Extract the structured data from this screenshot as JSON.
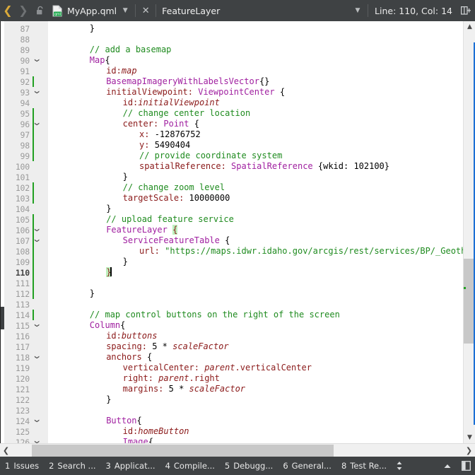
{
  "toolbar": {
    "back_icon": "chevron-left-icon",
    "forward_icon": "chevron-right-icon",
    "lock_icon": "unlocked-padlock-icon",
    "file_type_icon": "qml-file-icon",
    "file_type_label": "qml",
    "filename": "MyApp.qml",
    "file_dropdown_icon": "chevron-down-icon",
    "close_icon": "close-x-icon",
    "symbol": "FeatureLayer",
    "symbol_dropdown_icon": "chevron-down-icon",
    "cursor_position": "Line: 110, Col: 14",
    "split_icon": "split-editor-icon"
  },
  "editor": {
    "first_line": 87,
    "current_line": 110,
    "lines": [
      {
        "n": 87,
        "fold": false,
        "changed": false,
        "indent": 2,
        "tokens": [
          {
            "t": "}",
            "c": "tok-op"
          }
        ]
      },
      {
        "n": 88,
        "fold": false,
        "changed": false,
        "indent": 0,
        "tokens": []
      },
      {
        "n": 89,
        "fold": false,
        "changed": false,
        "indent": 2,
        "tokens": [
          {
            "t": "// add a basemap",
            "c": "tok-cm"
          }
        ]
      },
      {
        "n": 90,
        "fold": true,
        "changed": false,
        "indent": 2,
        "tokens": [
          {
            "t": "Map",
            "c": "tok-ty"
          },
          {
            "t": "{",
            "c": "tok-op"
          }
        ]
      },
      {
        "n": 91,
        "fold": false,
        "changed": false,
        "indent": 3,
        "tokens": [
          {
            "t": "id:",
            "c": "tok-pr"
          },
          {
            "t": "map",
            "c": "tok-id"
          }
        ]
      },
      {
        "n": 92,
        "fold": false,
        "changed": true,
        "indent": 3,
        "tokens": [
          {
            "t": "BasemapImageryWithLabelsVector",
            "c": "tok-ty"
          },
          {
            "t": "{}",
            "c": "tok-op"
          }
        ]
      },
      {
        "n": 93,
        "fold": true,
        "changed": false,
        "indent": 3,
        "tokens": [
          {
            "t": "initialViewpoint: ",
            "c": "tok-pr"
          },
          {
            "t": "ViewpointCenter",
            "c": "tok-ty"
          },
          {
            "t": " {",
            "c": "tok-op"
          }
        ]
      },
      {
        "n": 94,
        "fold": false,
        "changed": false,
        "indent": 4,
        "tokens": [
          {
            "t": "id:",
            "c": "tok-pr"
          },
          {
            "t": "initialViewpoint",
            "c": "tok-id"
          }
        ]
      },
      {
        "n": 95,
        "fold": false,
        "changed": true,
        "indent": 4,
        "tokens": [
          {
            "t": "// change center location",
            "c": "tok-cm"
          }
        ]
      },
      {
        "n": 96,
        "fold": true,
        "changed": true,
        "indent": 4,
        "tokens": [
          {
            "t": "center: ",
            "c": "tok-pr"
          },
          {
            "t": "Point",
            "c": "tok-ty"
          },
          {
            "t": " {",
            "c": "tok-op"
          }
        ]
      },
      {
        "n": 97,
        "fold": false,
        "changed": true,
        "indent": 5,
        "tokens": [
          {
            "t": "x: ",
            "c": "tok-pr"
          },
          {
            "t": "-12876752",
            "c": "tok-num"
          }
        ]
      },
      {
        "n": 98,
        "fold": false,
        "changed": true,
        "indent": 5,
        "tokens": [
          {
            "t": "y: ",
            "c": "tok-pr"
          },
          {
            "t": "5490404",
            "c": "tok-num"
          }
        ]
      },
      {
        "n": 99,
        "fold": false,
        "changed": true,
        "indent": 5,
        "tokens": [
          {
            "t": "// provide coordinate system",
            "c": "tok-cm"
          }
        ]
      },
      {
        "n": 100,
        "fold": false,
        "changed": false,
        "indent": 5,
        "tokens": [
          {
            "t": "spatialReference: ",
            "c": "tok-pr"
          },
          {
            "t": "SpatialReference",
            "c": "tok-ty"
          },
          {
            "t": " {wkid: ",
            "c": "tok-op"
          },
          {
            "t": "102100",
            "c": "tok-num"
          },
          {
            "t": "}",
            "c": "tok-op"
          }
        ]
      },
      {
        "n": 101,
        "fold": false,
        "changed": false,
        "indent": 4,
        "tokens": [
          {
            "t": "}",
            "c": "tok-op"
          }
        ]
      },
      {
        "n": 102,
        "fold": false,
        "changed": true,
        "indent": 4,
        "tokens": [
          {
            "t": "// change zoom level",
            "c": "tok-cm"
          }
        ]
      },
      {
        "n": 103,
        "fold": false,
        "changed": true,
        "indent": 4,
        "tokens": [
          {
            "t": "targetScale: ",
            "c": "tok-pr"
          },
          {
            "t": "10000000",
            "c": "tok-num"
          }
        ]
      },
      {
        "n": 104,
        "fold": false,
        "changed": false,
        "indent": 3,
        "tokens": [
          {
            "t": "}",
            "c": "tok-op"
          }
        ]
      },
      {
        "n": 105,
        "fold": false,
        "changed": true,
        "indent": 3,
        "tokens": [
          {
            "t": "// upload feature service",
            "c": "tok-cm"
          }
        ]
      },
      {
        "n": 106,
        "fold": true,
        "changed": true,
        "indent": 3,
        "tokens": [
          {
            "t": "FeatureLayer",
            "c": "tok-ty"
          },
          {
            "t": " ",
            "c": "tok-op"
          },
          {
            "t": "{",
            "c": "brace-hl"
          }
        ]
      },
      {
        "n": 107,
        "fold": true,
        "changed": true,
        "indent": 4,
        "tokens": [
          {
            "t": "ServiceFeatureTable",
            "c": "tok-ty"
          },
          {
            "t": " {",
            "c": "tok-op"
          }
        ]
      },
      {
        "n": 108,
        "fold": false,
        "changed": true,
        "indent": 5,
        "tokens": [
          {
            "t": "url: ",
            "c": "tok-pr"
          },
          {
            "t": "\"https://maps.idwr.idaho.gov/arcgis/rest/services/BP/_Geothermal",
            "c": "tok-str"
          }
        ]
      },
      {
        "n": 109,
        "fold": false,
        "changed": true,
        "indent": 4,
        "tokens": [
          {
            "t": "}",
            "c": "tok-op"
          }
        ]
      },
      {
        "n": 110,
        "fold": false,
        "changed": true,
        "indent": 3,
        "tokens": [
          {
            "t": "}",
            "c": "brace-hl"
          }
        ],
        "cursor": true
      },
      {
        "n": 111,
        "fold": false,
        "changed": true,
        "indent": 0,
        "tokens": []
      },
      {
        "n": 112,
        "fold": false,
        "changed": true,
        "indent": 2,
        "tokens": [
          {
            "t": "}",
            "c": "tok-op"
          }
        ]
      },
      {
        "n": 113,
        "fold": false,
        "changed": false,
        "indent": 0,
        "tokens": []
      },
      {
        "n": 114,
        "fold": false,
        "changed": true,
        "indent": 2,
        "tokens": [
          {
            "t": "// map control buttons on the right of the screen",
            "c": "tok-cm"
          }
        ]
      },
      {
        "n": 115,
        "fold": true,
        "changed": false,
        "indent": 2,
        "tokens": [
          {
            "t": "Column",
            "c": "tok-ty"
          },
          {
            "t": "{",
            "c": "tok-op"
          }
        ]
      },
      {
        "n": 116,
        "fold": false,
        "changed": false,
        "indent": 3,
        "tokens": [
          {
            "t": "id:",
            "c": "tok-pr"
          },
          {
            "t": "buttons",
            "c": "tok-id"
          }
        ]
      },
      {
        "n": 117,
        "fold": false,
        "changed": false,
        "indent": 3,
        "tokens": [
          {
            "t": "spacing: ",
            "c": "tok-pr"
          },
          {
            "t": "5",
            "c": "tok-num"
          },
          {
            "t": " * ",
            "c": "tok-op"
          },
          {
            "t": "scaleFactor",
            "c": "tok-id"
          }
        ]
      },
      {
        "n": 118,
        "fold": true,
        "changed": false,
        "indent": 3,
        "tokens": [
          {
            "t": "anchors ",
            "c": "tok-pr"
          },
          {
            "t": "{",
            "c": "tok-op"
          }
        ]
      },
      {
        "n": 119,
        "fold": false,
        "changed": false,
        "indent": 4,
        "tokens": [
          {
            "t": "verticalCenter: ",
            "c": "tok-pr"
          },
          {
            "t": "parent",
            "c": "tok-id"
          },
          {
            "t": ".verticalCenter",
            "c": "tok-pr"
          }
        ]
      },
      {
        "n": 120,
        "fold": false,
        "changed": false,
        "indent": 4,
        "tokens": [
          {
            "t": "right: ",
            "c": "tok-pr"
          },
          {
            "t": "parent",
            "c": "tok-id"
          },
          {
            "t": ".right",
            "c": "tok-pr"
          }
        ]
      },
      {
        "n": 121,
        "fold": false,
        "changed": false,
        "indent": 4,
        "tokens": [
          {
            "t": "margins: ",
            "c": "tok-pr"
          },
          {
            "t": "5",
            "c": "tok-num"
          },
          {
            "t": " * ",
            "c": "tok-op"
          },
          {
            "t": "scaleFactor",
            "c": "tok-id"
          }
        ]
      },
      {
        "n": 122,
        "fold": false,
        "changed": false,
        "indent": 3,
        "tokens": [
          {
            "t": "}",
            "c": "tok-op"
          }
        ]
      },
      {
        "n": 123,
        "fold": false,
        "changed": false,
        "indent": 0,
        "tokens": []
      },
      {
        "n": 124,
        "fold": true,
        "changed": false,
        "indent": 3,
        "tokens": [
          {
            "t": "Button",
            "c": "tok-ty"
          },
          {
            "t": "{",
            "c": "tok-op"
          }
        ]
      },
      {
        "n": 125,
        "fold": false,
        "changed": false,
        "indent": 4,
        "tokens": [
          {
            "t": "id:",
            "c": "tok-pr"
          },
          {
            "t": "homeButton",
            "c": "tok-id"
          }
        ]
      },
      {
        "n": 126,
        "fold": true,
        "changed": false,
        "indent": 4,
        "tokens": [
          {
            "t": "Image",
            "c": "tok-ty"
          },
          {
            "t": "{",
            "c": "tok-op"
          }
        ]
      }
    ]
  },
  "scrollbars": {
    "vertical_up_icon": "chevron-up-icon",
    "vertical_down_icon": "chevron-down-icon",
    "horizontal_left_icon": "chevron-left-icon",
    "horizontal_right_icon": "chevron-right-icon"
  },
  "statusbar": {
    "items": [
      {
        "num": "1",
        "label": "Issues"
      },
      {
        "num": "2",
        "label": "Search ..."
      },
      {
        "num": "3",
        "label": "Applicat..."
      },
      {
        "num": "4",
        "label": "Compile..."
      },
      {
        "num": "5",
        "label": "Debugg..."
      },
      {
        "num": "6",
        "label": "General..."
      },
      {
        "num": "8",
        "label": "Test Re..."
      }
    ],
    "updown_icon": "up-down-arrows-icon",
    "collapse_icon": "caret-up-icon",
    "panel_icon": "toggle-panel-icon"
  },
  "colors": {
    "chrome": "#3f4244",
    "gutter": "#eeeeee",
    "change_bar": "#22a022",
    "comment": "#1f8b1f",
    "type": "#a020a0",
    "property": "#8b1a1a",
    "brace_match": "#bdf0bd",
    "accent_blue": "#1a6fd4",
    "nav_active": "#d9a93a"
  }
}
